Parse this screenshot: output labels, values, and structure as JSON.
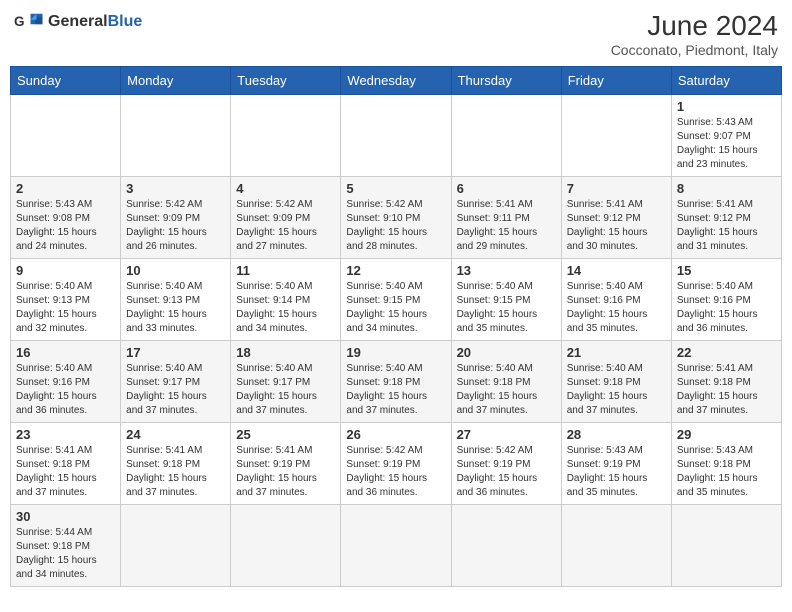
{
  "header": {
    "logo_general": "General",
    "logo_blue": "Blue",
    "title": "June 2024",
    "subtitle": "Cocconato, Piedmont, Italy"
  },
  "weekdays": [
    "Sunday",
    "Monday",
    "Tuesday",
    "Wednesday",
    "Thursday",
    "Friday",
    "Saturday"
  ],
  "weeks": [
    [
      {
        "day": "",
        "info": ""
      },
      {
        "day": "",
        "info": ""
      },
      {
        "day": "",
        "info": ""
      },
      {
        "day": "",
        "info": ""
      },
      {
        "day": "",
        "info": ""
      },
      {
        "day": "",
        "info": ""
      },
      {
        "day": "1",
        "info": "Sunrise: 5:43 AM\nSunset: 9:07 PM\nDaylight: 15 hours\nand 23 minutes."
      }
    ],
    [
      {
        "day": "2",
        "info": "Sunrise: 5:43 AM\nSunset: 9:08 PM\nDaylight: 15 hours\nand 24 minutes."
      },
      {
        "day": "3",
        "info": "Sunrise: 5:42 AM\nSunset: 9:09 PM\nDaylight: 15 hours\nand 26 minutes."
      },
      {
        "day": "4",
        "info": "Sunrise: 5:42 AM\nSunset: 9:09 PM\nDaylight: 15 hours\nand 27 minutes."
      },
      {
        "day": "5",
        "info": "Sunrise: 5:42 AM\nSunset: 9:10 PM\nDaylight: 15 hours\nand 28 minutes."
      },
      {
        "day": "6",
        "info": "Sunrise: 5:41 AM\nSunset: 9:11 PM\nDaylight: 15 hours\nand 29 minutes."
      },
      {
        "day": "7",
        "info": "Sunrise: 5:41 AM\nSunset: 9:12 PM\nDaylight: 15 hours\nand 30 minutes."
      },
      {
        "day": "8",
        "info": "Sunrise: 5:41 AM\nSunset: 9:12 PM\nDaylight: 15 hours\nand 31 minutes."
      }
    ],
    [
      {
        "day": "9",
        "info": "Sunrise: 5:40 AM\nSunset: 9:13 PM\nDaylight: 15 hours\nand 32 minutes."
      },
      {
        "day": "10",
        "info": "Sunrise: 5:40 AM\nSunset: 9:13 PM\nDaylight: 15 hours\nand 33 minutes."
      },
      {
        "day": "11",
        "info": "Sunrise: 5:40 AM\nSunset: 9:14 PM\nDaylight: 15 hours\nand 34 minutes."
      },
      {
        "day": "12",
        "info": "Sunrise: 5:40 AM\nSunset: 9:15 PM\nDaylight: 15 hours\nand 34 minutes."
      },
      {
        "day": "13",
        "info": "Sunrise: 5:40 AM\nSunset: 9:15 PM\nDaylight: 15 hours\nand 35 minutes."
      },
      {
        "day": "14",
        "info": "Sunrise: 5:40 AM\nSunset: 9:16 PM\nDaylight: 15 hours\nand 35 minutes."
      },
      {
        "day": "15",
        "info": "Sunrise: 5:40 AM\nSunset: 9:16 PM\nDaylight: 15 hours\nand 36 minutes."
      }
    ],
    [
      {
        "day": "16",
        "info": "Sunrise: 5:40 AM\nSunset: 9:16 PM\nDaylight: 15 hours\nand 36 minutes."
      },
      {
        "day": "17",
        "info": "Sunrise: 5:40 AM\nSunset: 9:17 PM\nDaylight: 15 hours\nand 37 minutes."
      },
      {
        "day": "18",
        "info": "Sunrise: 5:40 AM\nSunset: 9:17 PM\nDaylight: 15 hours\nand 37 minutes."
      },
      {
        "day": "19",
        "info": "Sunrise: 5:40 AM\nSunset: 9:18 PM\nDaylight: 15 hours\nand 37 minutes."
      },
      {
        "day": "20",
        "info": "Sunrise: 5:40 AM\nSunset: 9:18 PM\nDaylight: 15 hours\nand 37 minutes."
      },
      {
        "day": "21",
        "info": "Sunrise: 5:40 AM\nSunset: 9:18 PM\nDaylight: 15 hours\nand 37 minutes."
      },
      {
        "day": "22",
        "info": "Sunrise: 5:41 AM\nSunset: 9:18 PM\nDaylight: 15 hours\nand 37 minutes."
      }
    ],
    [
      {
        "day": "23",
        "info": "Sunrise: 5:41 AM\nSunset: 9:18 PM\nDaylight: 15 hours\nand 37 minutes."
      },
      {
        "day": "24",
        "info": "Sunrise: 5:41 AM\nSunset: 9:18 PM\nDaylight: 15 hours\nand 37 minutes."
      },
      {
        "day": "25",
        "info": "Sunrise: 5:41 AM\nSunset: 9:19 PM\nDaylight: 15 hours\nand 37 minutes."
      },
      {
        "day": "26",
        "info": "Sunrise: 5:42 AM\nSunset: 9:19 PM\nDaylight: 15 hours\nand 36 minutes."
      },
      {
        "day": "27",
        "info": "Sunrise: 5:42 AM\nSunset: 9:19 PM\nDaylight: 15 hours\nand 36 minutes."
      },
      {
        "day": "28",
        "info": "Sunrise: 5:43 AM\nSunset: 9:19 PM\nDaylight: 15 hours\nand 35 minutes."
      },
      {
        "day": "29",
        "info": "Sunrise: 5:43 AM\nSunset: 9:18 PM\nDaylight: 15 hours\nand 35 minutes."
      }
    ],
    [
      {
        "day": "30",
        "info": "Sunrise: 5:44 AM\nSunset: 9:18 PM\nDaylight: 15 hours\nand 34 minutes."
      },
      {
        "day": "",
        "info": ""
      },
      {
        "day": "",
        "info": ""
      },
      {
        "day": "",
        "info": ""
      },
      {
        "day": "",
        "info": ""
      },
      {
        "day": "",
        "info": ""
      },
      {
        "day": "",
        "info": ""
      }
    ]
  ]
}
